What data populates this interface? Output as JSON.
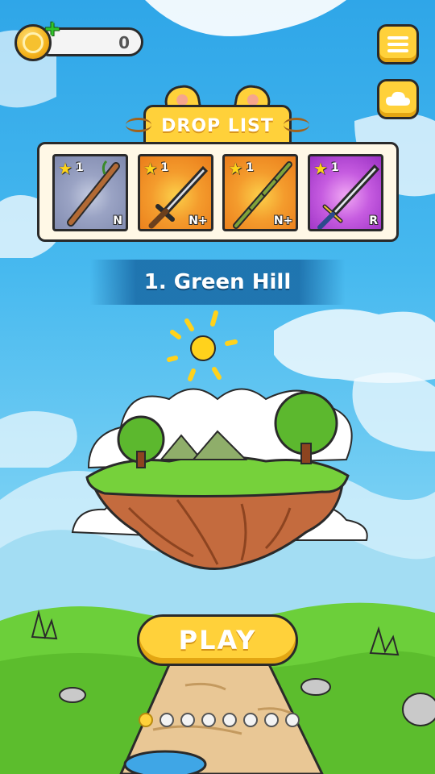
{
  "hud": {
    "coins": "0",
    "coin_icon": "coin-icon",
    "add_icon": "plus-icon",
    "menu_icon": "menu-icon",
    "cloud_icon": "cloud-icon"
  },
  "drop_list": {
    "title": "DROP LIST",
    "items": [
      {
        "name": "wooden-staff",
        "stars": "1",
        "rarity": "N",
        "color": "#9aa3c4"
      },
      {
        "name": "short-sword",
        "stars": "1",
        "rarity": "N+",
        "color": "#f49c2d"
      },
      {
        "name": "bamboo-spear",
        "stars": "1",
        "rarity": "N+",
        "color": "#f49c2d"
      },
      {
        "name": "long-sword",
        "stars": "1",
        "rarity": "R",
        "color": "#c65ce0"
      }
    ]
  },
  "stage": {
    "title": "1. Green Hill"
  },
  "play_label": "PLAY",
  "pagination": {
    "total": 8,
    "active_index": 0
  },
  "colors": {
    "accent": "#ffd13a",
    "sky": "#47b9ef",
    "grass": "#6ccf3a"
  }
}
